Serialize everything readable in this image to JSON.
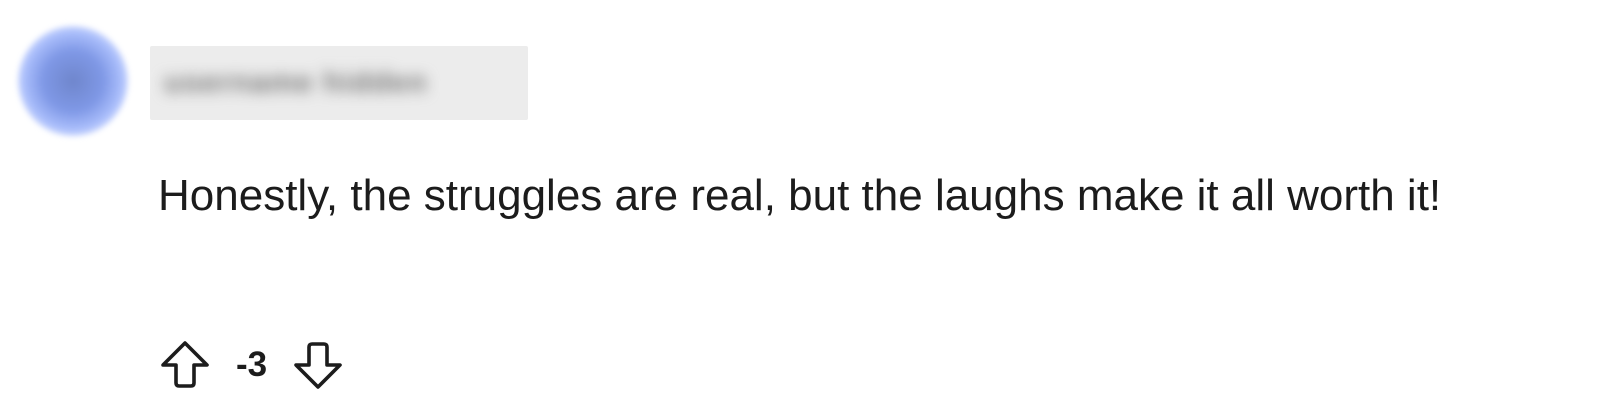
{
  "comment": {
    "author": {
      "username": "username hidden",
      "avatar_color": "#7f98e6"
    },
    "body": "Honestly, the struggles are real, but the laughs make it all worth it!",
    "score": "-3",
    "actions": {
      "upvote_icon": "arrow-up-outline-icon",
      "downvote_icon": "arrow-down-outline-icon"
    }
  }
}
